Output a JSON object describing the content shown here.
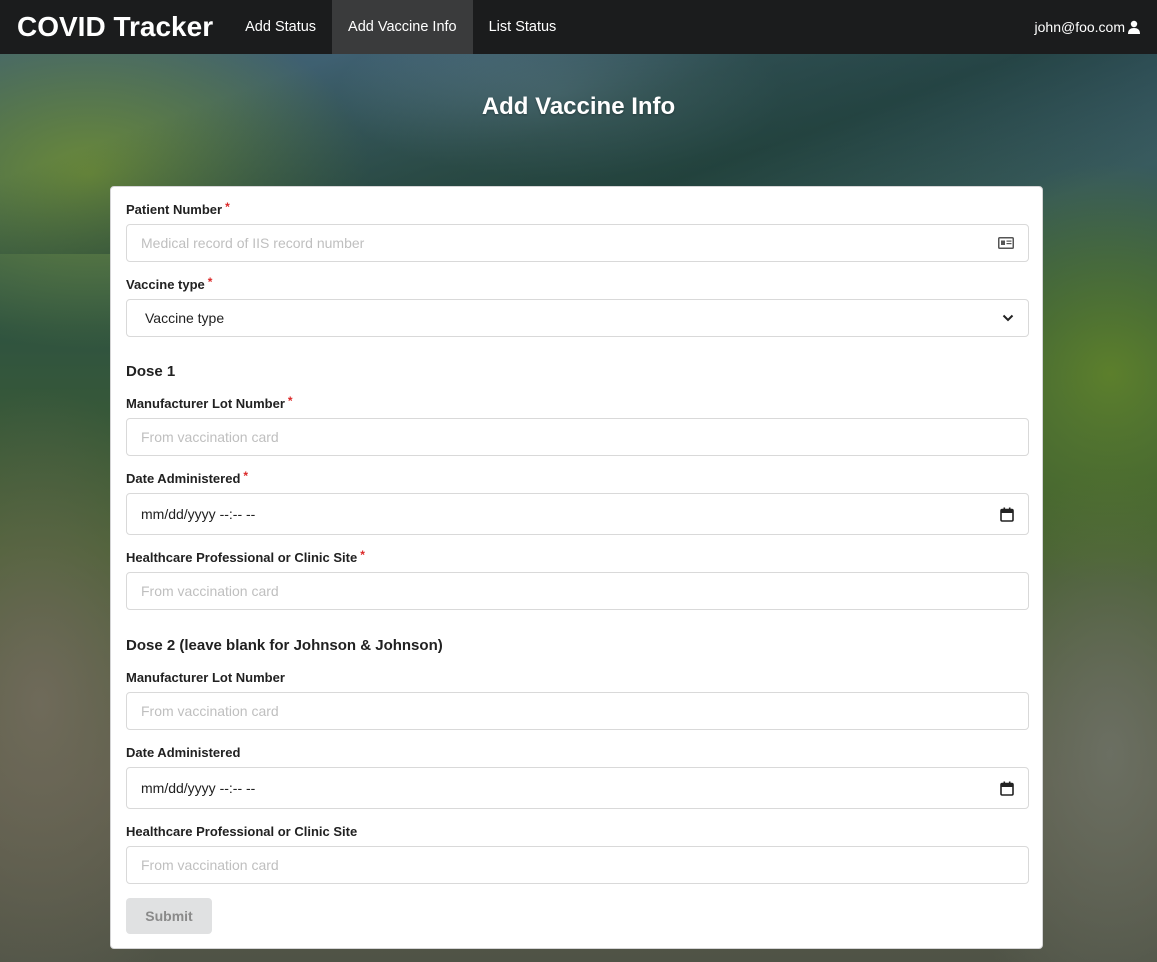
{
  "navbar": {
    "brand": "COVID Tracker",
    "items": [
      {
        "label": "Add Status",
        "active": false
      },
      {
        "label": "Add Vaccine Info",
        "active": true
      },
      {
        "label": "List Status",
        "active": false
      }
    ],
    "user_email": "john@foo.com",
    "user_icon": "user-icon"
  },
  "page": {
    "title": "Add Vaccine Info"
  },
  "form": {
    "patient_number": {
      "label": "Patient Number",
      "required_mark": "*",
      "placeholder": "Medical record of IIS record number",
      "icon": "id-card-icon"
    },
    "vaccine_type": {
      "label": "Vaccine type",
      "required_mark": "*",
      "selected": "Vaccine type",
      "icon": "chevron-down-icon"
    },
    "dose1": {
      "heading": "Dose 1",
      "lot_number": {
        "label": "Manufacturer Lot Number",
        "required_mark": "*",
        "placeholder": "From vaccination card"
      },
      "date": {
        "label": "Date Administered",
        "required_mark": "*",
        "value": "mm/dd/yyyy --:-- --",
        "icon": "calendar-icon"
      },
      "site": {
        "label": "Healthcare Professional or Clinic Site",
        "required_mark": "*",
        "placeholder": "From vaccination card"
      }
    },
    "dose2": {
      "heading": "Dose 2 (leave blank for Johnson & Johnson)",
      "lot_number": {
        "label": "Manufacturer Lot Number",
        "placeholder": "From vaccination card"
      },
      "date": {
        "label": "Date Administered",
        "value": "mm/dd/yyyy --:-- --",
        "icon": "calendar-icon"
      },
      "site": {
        "label": "Healthcare Professional or Clinic Site",
        "placeholder": "From vaccination card"
      }
    },
    "submit_label": "Submit"
  },
  "colors": {
    "navbar_bg": "#1b1c1d",
    "active_tab_bg": "#3a3b3c",
    "required": "#db2828",
    "submit_bg": "#e0e1e2"
  }
}
